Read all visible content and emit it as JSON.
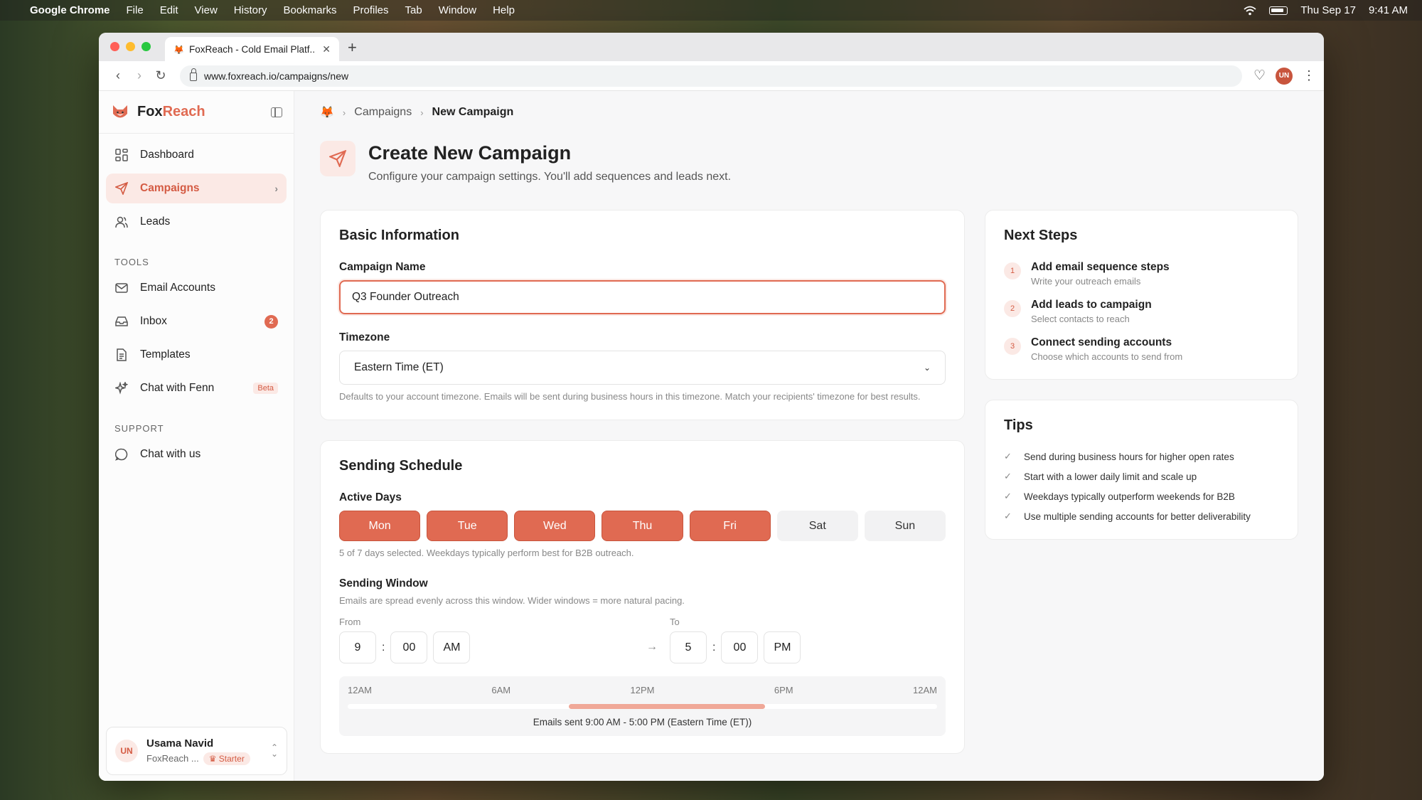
{
  "menubar": {
    "app": "Google Chrome",
    "items": [
      "File",
      "Edit",
      "View",
      "History",
      "Bookmarks",
      "Profiles",
      "Tab",
      "Window",
      "Help"
    ],
    "date": "Thu Sep 17",
    "time": "9:41 AM"
  },
  "browser": {
    "tab_title": "FoxReach - Cold Email Platf...",
    "url": "www.foxreach.io/campaigns/new",
    "profile_initials": "UN"
  },
  "brand": {
    "name_a": "Fox",
    "name_b": "Reach"
  },
  "sidebar": {
    "main_items": [
      {
        "label": "Dashboard"
      },
      {
        "label": "Campaigns"
      },
      {
        "label": "Leads"
      }
    ],
    "tools_heading": "TOOLS",
    "tools_items": [
      {
        "label": "Email Accounts"
      },
      {
        "label": "Inbox",
        "badge": "2"
      },
      {
        "label": "Templates"
      },
      {
        "label": "Chat with Fenn",
        "tag": "Beta"
      }
    ],
    "support_heading": "SUPPORT",
    "support_items": [
      {
        "label": "Chat with us"
      }
    ],
    "user": {
      "initials": "UN",
      "name": "Usama Navid",
      "org": "FoxReach ...",
      "plan": "Starter"
    }
  },
  "breadcrumb": {
    "parent": "Campaigns",
    "current": "New Campaign"
  },
  "page": {
    "title": "Create New Campaign",
    "subtitle": "Configure your campaign settings. You'll add sequences and leads next."
  },
  "basic": {
    "heading": "Basic Information",
    "name_label": "Campaign Name",
    "name_value": "Q3 Founder Outreach",
    "tz_label": "Timezone",
    "tz_value": "Eastern Time (ET)",
    "tz_help": "Defaults to your account timezone. Emails will be sent during business hours in this timezone. Match your recipients' timezone for best results."
  },
  "schedule": {
    "heading": "Sending Schedule",
    "days_label": "Active Days",
    "days": [
      {
        "label": "Mon",
        "on": true
      },
      {
        "label": "Tue",
        "on": true
      },
      {
        "label": "Wed",
        "on": true
      },
      {
        "label": "Thu",
        "on": true
      },
      {
        "label": "Fri",
        "on": true
      },
      {
        "label": "Sat",
        "on": false
      },
      {
        "label": "Sun",
        "on": false
      }
    ],
    "days_help": "5 of 7 days selected. Weekdays typically perform best for B2B outreach.",
    "window_label": "Sending Window",
    "window_help": "Emails are spread evenly across this window. Wider windows = more natural pacing.",
    "from_label": "From",
    "from": {
      "hour": "9",
      "min": "00",
      "ampm": "AM"
    },
    "to_label": "To",
    "to": {
      "hour": "5",
      "min": "00",
      "ampm": "PM"
    },
    "timeline_ticks": [
      "12AM",
      "6AM",
      "12PM",
      "6PM",
      "12AM"
    ],
    "range_start_hour": 9,
    "range_end_hour": 17,
    "timeline_caption": "Emails sent 9:00 AM - 5:00 PM (Eastern Time (ET))"
  },
  "next_steps": {
    "heading": "Next Steps",
    "items": [
      {
        "num": "1",
        "title": "Add email sequence steps",
        "desc": "Write your outreach emails"
      },
      {
        "num": "2",
        "title": "Add leads to campaign",
        "desc": "Select contacts to reach"
      },
      {
        "num": "3",
        "title": "Connect sending accounts",
        "desc": "Choose which accounts to send from"
      }
    ]
  },
  "tips": {
    "heading": "Tips",
    "items": [
      "Send during business hours for higher open rates",
      "Start with a lower daily limit and scale up",
      "Weekdays typically outperform weekends for B2B",
      "Use multiple sending accounts for better deliverability"
    ]
  },
  "colors": {
    "accent": "#e06a52",
    "accent_soft": "#fbe9e5"
  }
}
